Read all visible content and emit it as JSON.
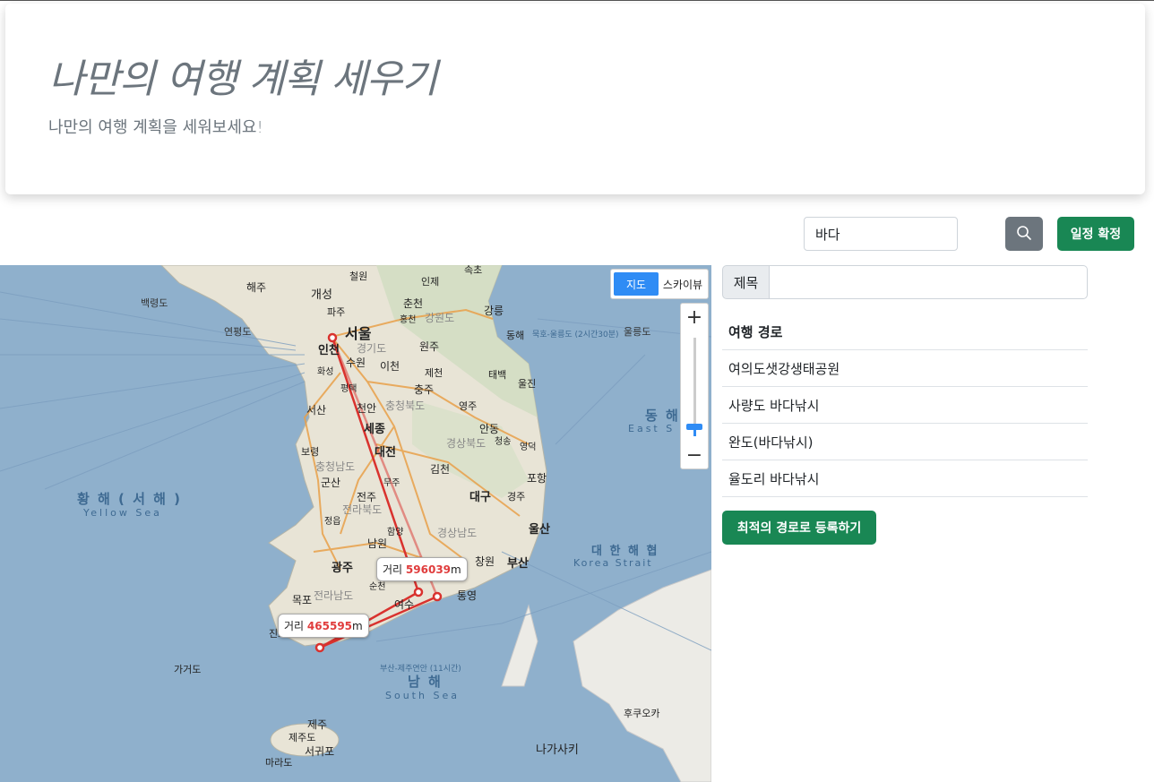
{
  "header": {
    "title": "나만의 여행 계획 세우기",
    "subtitle": "나만의 여행 계획을 세워보세요!"
  },
  "search": {
    "value": "바다",
    "button_icon": "search-icon"
  },
  "actions": {
    "confirm_label": "일정 확정",
    "register_label": "최적의 경로로 등록하기"
  },
  "map": {
    "type_options": [
      "지도",
      "스카이뷰"
    ],
    "active_type": "지도",
    "zoom_in": "+",
    "zoom_out": "−",
    "zoom_level_fraction": 0.1,
    "distance_prefix": "거리",
    "distance_unit": "m",
    "distances": [
      "596039",
      "465595"
    ],
    "labels": {
      "seoul": "서울",
      "incheon": "인천",
      "gaesong": "개성",
      "haeju": "해주",
      "paju": "파주",
      "cheorwon": "철원",
      "inje": "인제",
      "sokcho": "속초",
      "chuncheon": "춘천",
      "hongcheon": "홍천",
      "gangwon": "강원도",
      "gangneung": "강릉",
      "donghae": "동해",
      "wonju": "원주",
      "gyeonggi": "경기도",
      "suwon": "수원",
      "icheon": "이천",
      "hwaseong": "화성",
      "pyeongtaek": "평택",
      "jecheon": "제천",
      "chungju": "충주",
      "taebaek": "태백",
      "uljin": "울진",
      "yeongju": "영주",
      "seosan": "서산",
      "cheonan": "천안",
      "chungbuk": "충청북도",
      "sejong": "세종",
      "andong": "안동",
      "boryeong": "보령",
      "daejeon": "대전",
      "gyeongbuk": "경상북도",
      "cheongsong": "청송",
      "yeongdeok": "영덕",
      "chungnam": "충청남도",
      "gimcheon": "김천",
      "pohang": "포항",
      "gunsan": "군산",
      "muju": "무주",
      "jeonju": "전주",
      "daegu": "대구",
      "gyeongju": "경주",
      "jeonbuk": "전라북도",
      "jeongeup": "정읍",
      "hamyang": "함양",
      "ulsan": "울산",
      "namwon": "남원",
      "gyeongnam": "경상남도",
      "changwon": "창원",
      "busan": "부산",
      "gwangju": "광주",
      "suncheon": "순천",
      "mokpo": "목포",
      "jeonnam": "전라남도",
      "yeosu": "여수",
      "tongyeong": "통영",
      "jindo": "진도",
      "gageodo": "가거도",
      "jeju": "제주",
      "jejudo": "제주도",
      "seogwipo": "서귀포",
      "marado": "마라도",
      "fukuoka": "후쿠오카",
      "nagasaki": "나가사키",
      "yeonpyeong": "연평도",
      "baengnyeong": "백령도",
      "ulleung": "울릉도",
      "yellow_sea_ko": "황 해 ( 서 해 )",
      "yellow_sea_en": "Yellow Sea",
      "east_sea_ko": "동 해",
      "east_sea_en": "East S",
      "korea_strait_ko": "대 한 해 협",
      "korea_strait_en": "Korea Strait",
      "south_sea_ko": "남 해",
      "south_sea_en": "South Sea",
      "busan_jeju_ferry": "부산-제주연안 (11시간)",
      "mokpo_ulleung": "묵호-울릉도 (2시간30분)"
    }
  },
  "plan": {
    "title_label": "제목",
    "title_value": "",
    "route_header": "여행 경로",
    "route_items": [
      "여의도샛강생태공원",
      "사량도 바다낚시",
      "완도(바다낚시)",
      "율도리 바다낚시"
    ]
  },
  "colors": {
    "primary_green": "#198754",
    "secondary_gray": "#6c757d",
    "route_red": "#d9322e",
    "sea_blue": "#8fb0cc",
    "land": "#e8e4d6"
  }
}
